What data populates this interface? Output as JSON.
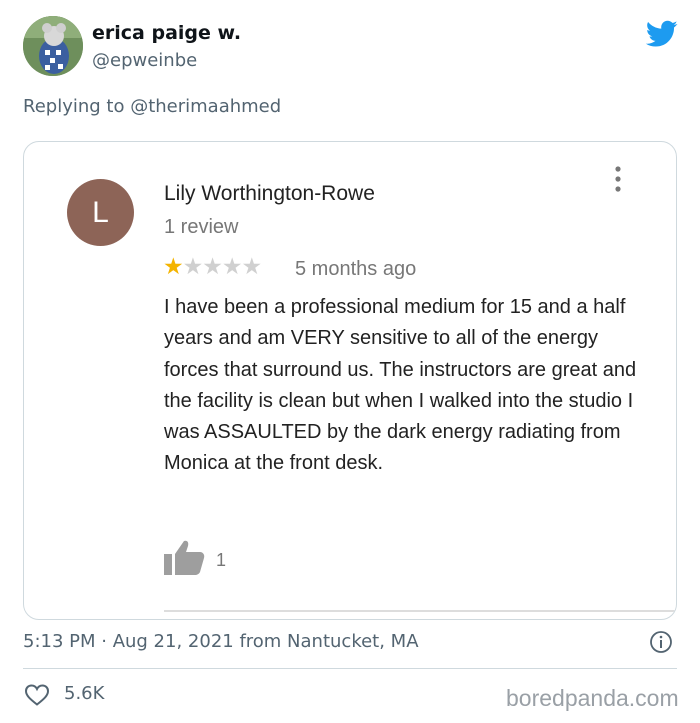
{
  "tweet": {
    "display_name": "erica paige w.",
    "handle": "@epweinbe",
    "replying_prefix": "Replying to ",
    "replying_to": "@therimaahmed",
    "timestamp": "5:13 PM · Aug 21, 2021 from Nantucket, MA",
    "likes": "5.6K"
  },
  "review": {
    "avatar_letter": "L",
    "reviewer_name": "Lily Worthington-Rowe",
    "review_count": "1 review",
    "rating": 1,
    "max_rating": 5,
    "time_ago": "5 months ago",
    "text": "I have been a professional medium for 15 and a half years and am VERY sensitive to all of the energy forces that surround us. The instructors are great and the facility is clean but when I walked into the studio I was ASSAULTED by the dark energy radiating from Monica at the front desk.",
    "helpful_count": "1"
  },
  "watermark": "boredpanda.com",
  "icons": {
    "brand": "twitter-bird-icon",
    "menu": "kebab-menu-icon",
    "helpful": "thumbs-up-icon",
    "info": "info-icon",
    "like": "heart-icon"
  },
  "colors": {
    "twitter_blue": "#1d9bf0",
    "star_filled": "#f4b400",
    "star_empty": "#d0d0d0",
    "reviewer_avatar": "#8d6457"
  }
}
